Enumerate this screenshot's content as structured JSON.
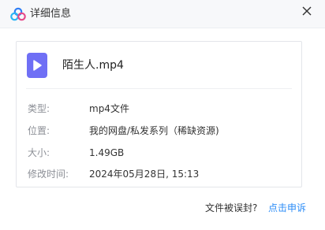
{
  "window": {
    "title": "详细信息",
    "logo_icon": "cloud-logo-icon",
    "close_icon": "close-icon"
  },
  "file": {
    "name": "陌生人.mp4",
    "icon": "video-file-icon"
  },
  "details": [
    {
      "label": "类型:",
      "value": "mp4文件"
    },
    {
      "label": "位置:",
      "value": "我的网盘/私发系列（稀缺资源)"
    },
    {
      "label": "大小:",
      "value": "1.49GB"
    },
    {
      "label": "修改时间:",
      "value": "2024年05月28日, 15:13"
    }
  ],
  "footer": {
    "question": "文件被误封?",
    "appeal_link": "点击申诉"
  },
  "colors": {
    "accent": "#2b8cf7",
    "file_icon": "#6f6ff5"
  }
}
